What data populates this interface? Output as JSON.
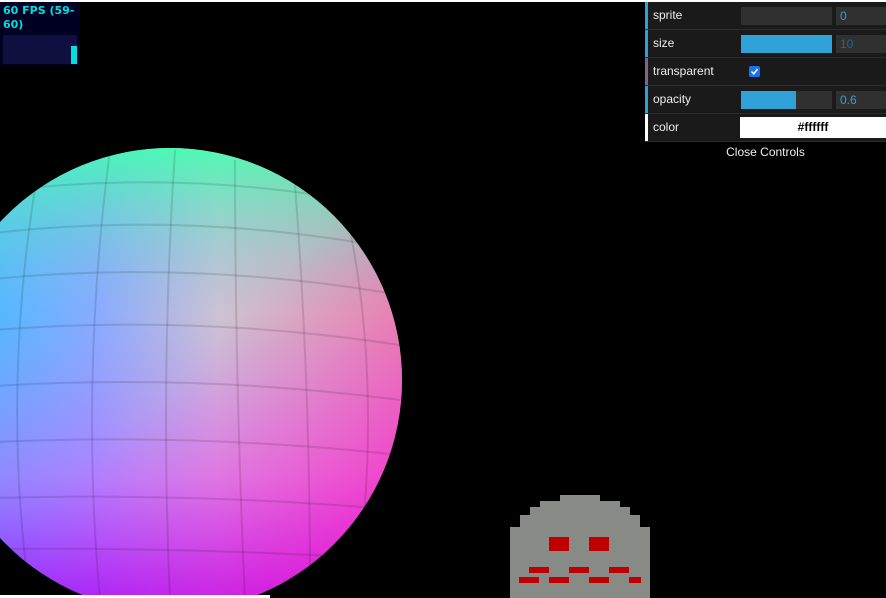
{
  "stats": {
    "fps_text": "60 FPS (59-60)",
    "color": "#00e0e0"
  },
  "gui": {
    "rows": [
      {
        "label": "sprite",
        "value": "0",
        "type": "slider",
        "fill": 0
      },
      {
        "label": "size",
        "value": "10",
        "type": "slider",
        "fill": 1.0
      },
      {
        "label": "transparent",
        "type": "checkbox",
        "checked": true
      },
      {
        "label": "opacity",
        "value": "0.6",
        "type": "slider",
        "fill": 0.6
      },
      {
        "label": "color",
        "value": "#ffffff",
        "type": "color"
      }
    ],
    "close_label": "Close Controls",
    "accent_color": "#2fa1d6"
  }
}
